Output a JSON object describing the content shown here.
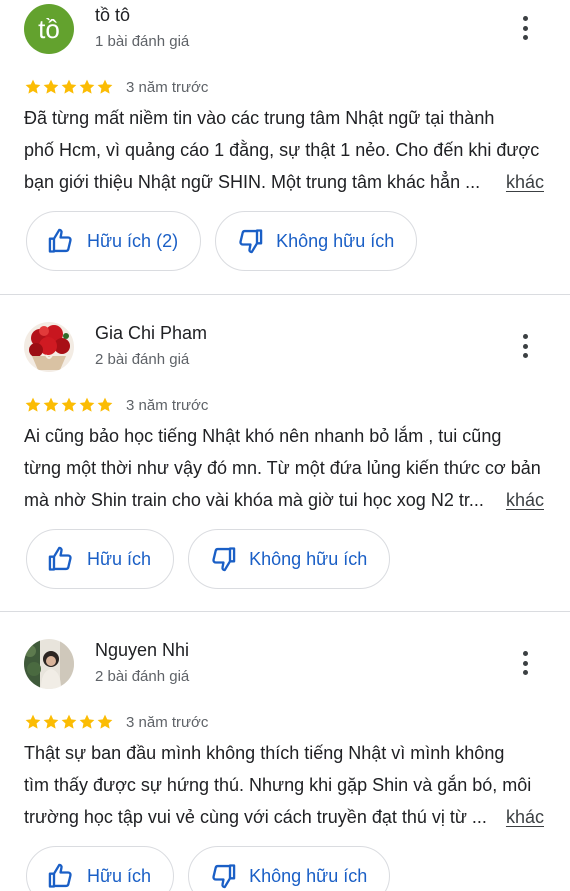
{
  "reviews": [
    {
      "avatar_letter": "tồ",
      "avatar_color": "#63a22e",
      "name": "tồ tô",
      "review_count": "1 bài đánh giá",
      "rating": 5,
      "date": "3 năm trước",
      "text_lines": [
        "Đã từng mất niềm tin vào các trung tâm Nhật ngữ tại thành",
        "phố Hcm, vì quảng cáo 1 đằng, sự thật 1 nẻo. Cho đến khi được",
        "bạn giới thiệu Nhật ngữ SHIN. Một trung tâm khác hẳn ..."
      ],
      "more_label": "khác",
      "helpful_label": "Hữu ích (2)",
      "not_helpful_label": "Không hữu ích"
    },
    {
      "name": "Gia Chi Pham",
      "review_count": "2 bài đánh giá",
      "rating": 5,
      "date": "3 năm trước",
      "text_lines": [
        "Ai cũng bảo học tiếng Nhật khó nên nhanh bỏ lắm , tui cũng",
        "từng một thời như vậy đó mn. Từ một đứa lủng kiến thức cơ bản",
        "mà nhờ Shin train cho vài khóa mà giờ tui học xog N2 tr..."
      ],
      "more_label": "khác",
      "helpful_label": "Hữu ích",
      "not_helpful_label": "Không hữu ích"
    },
    {
      "name": "Nguyen Nhi",
      "review_count": "2 bài đánh giá",
      "rating": 5,
      "date": "3 năm trước",
      "text_lines": [
        "Thật sự ban đầu mình không thích tiếng Nhật vì mình không",
        "tìm thấy được sự hứng thú. Nhưng khi gặp Shin và gắn bó, môi",
        "trường học tập vui vẻ cùng với cách truyền đạt thú vị từ ..."
      ],
      "more_label": "khác",
      "helpful_label": "Hữu ích",
      "not_helpful_label": "Không hữu ích"
    }
  ],
  "colors": {
    "star": "#fbbc04",
    "accent": "#1a5fc6",
    "border": "#dadce0",
    "secondary_text": "#5f6368"
  },
  "icons": {
    "more": "more-vert-icon",
    "star": "star-icon",
    "helpful": "thumb-up-icon",
    "not_helpful": "thumb-down-icon"
  }
}
